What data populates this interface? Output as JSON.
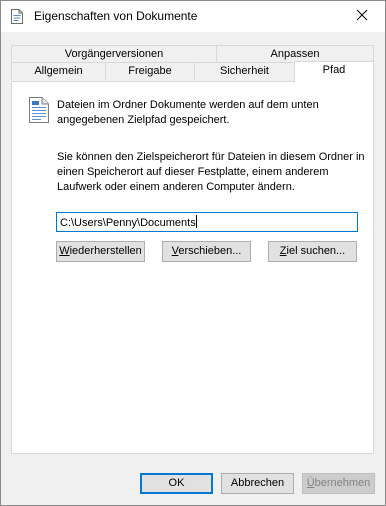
{
  "window": {
    "title": "Eigenschaften von Dokumente"
  },
  "tabs": {
    "row1": [
      {
        "label": "Vorgängerversionen"
      },
      {
        "label": "Anpassen"
      }
    ],
    "row2": [
      {
        "label": "Allgemein"
      },
      {
        "label": "Freigabe"
      },
      {
        "label": "Sicherheit"
      },
      {
        "label": "Pfad"
      }
    ],
    "active": "Pfad"
  },
  "pfad": {
    "info_text": "Dateien im Ordner Dokumente werden auf dem unten angegebenen Zielpfad gespeichert.",
    "description": "Sie können den Zielspeicherort für Dateien in diesem Ordner in einen Speicherort auf dieser Festplatte, einem anderem Laufwerk oder einem anderen Computer ändern.",
    "path_value": "C:\\Users\\Penny\\Documents",
    "restore_label": {
      "mnemonic": "W",
      "rest": "iederherstellen"
    },
    "move_label": {
      "mnemonic": "V",
      "rest": "erschieben..."
    },
    "find_target_label": {
      "mnemonic": "Z",
      "rest": "iel suchen..."
    }
  },
  "footer": {
    "ok_label": "OK",
    "cancel_label": "Abbrechen",
    "apply_label": {
      "mnemonic": "Ü",
      "rest": "bernehmen"
    }
  },
  "icons": {
    "title": "document-properties-icon",
    "close": "close-icon",
    "info": "document-icon"
  },
  "colors": {
    "accent": "#0078d7",
    "dialog_bg": "#f0f0f0",
    "button_bg": "#e1e1e1",
    "disabled_text": "#838383"
  }
}
